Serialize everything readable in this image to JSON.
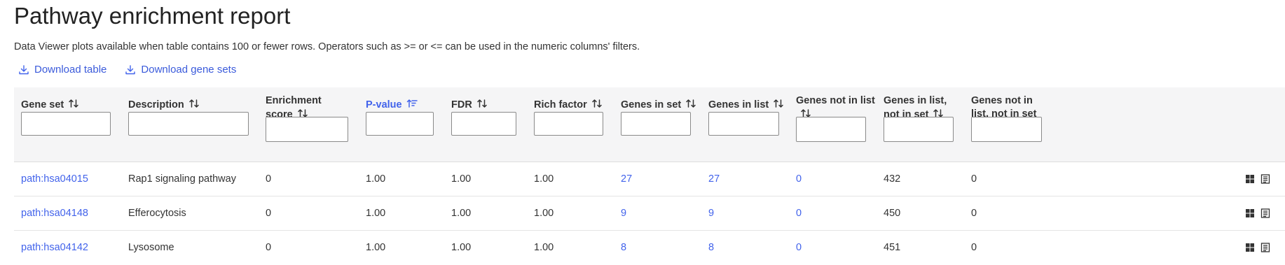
{
  "page": {
    "title": "Pathway enrichment report",
    "subtitle": "Data Viewer plots available when table contains 100 or fewer rows. Operators such as >= or <= can be used in the numeric columns' filters."
  },
  "actions": {
    "download_table": "Download table",
    "download_gene_sets": "Download gene sets"
  },
  "colors": {
    "accent": "#4263eb",
    "header_bg": "#f5f5f6",
    "text": "#333333"
  },
  "columns": [
    {
      "label": "Gene set",
      "sort": "unsorted"
    },
    {
      "label": "Description",
      "sort": "unsorted"
    },
    {
      "label": "Enrichment score",
      "sort": "unsorted"
    },
    {
      "label": "P-value",
      "sort": "ascending"
    },
    {
      "label": "FDR",
      "sort": "unsorted"
    },
    {
      "label": "Rich factor",
      "sort": "unsorted"
    },
    {
      "label": "Genes in set",
      "sort": "unsorted"
    },
    {
      "label": "Genes in list",
      "sort": "unsorted"
    },
    {
      "label": "Genes not in list",
      "sort": "unsorted"
    },
    {
      "label": "Genes in list, not in set",
      "sort": "unsorted"
    },
    {
      "label": "Genes not in list, not in set",
      "sort": "unsorted"
    }
  ],
  "rows": [
    {
      "gene_set": "path:hsa04015",
      "description": "Rap1 signaling pathway",
      "enrichment_score": "0",
      "p_value": "1.00",
      "fdr": "1.00",
      "rich_factor": "1.00",
      "genes_in_set": "27",
      "genes_in_list": "27",
      "genes_not_in_list": "0",
      "genes_in_list_not_in_set": "432",
      "genes_not_in_list_not_in_set": "0"
    },
    {
      "gene_set": "path:hsa04148",
      "description": "Efferocytosis",
      "enrichment_score": "0",
      "p_value": "1.00",
      "fdr": "1.00",
      "rich_factor": "1.00",
      "genes_in_set": "9",
      "genes_in_list": "9",
      "genes_not_in_list": "0",
      "genes_in_list_not_in_set": "450",
      "genes_not_in_list_not_in_set": "0"
    },
    {
      "gene_set": "path:hsa04142",
      "description": "Lysosome",
      "enrichment_score": "0",
      "p_value": "1.00",
      "fdr": "1.00",
      "rich_factor": "1.00",
      "genes_in_set": "8",
      "genes_in_list": "8",
      "genes_not_in_list": "0",
      "genes_in_list_not_in_set": "451",
      "genes_not_in_list_not_in_set": "0"
    }
  ]
}
